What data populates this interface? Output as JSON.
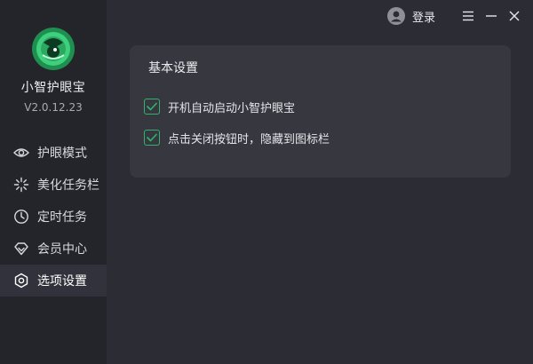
{
  "app": {
    "name": "小智护眼宝",
    "version": "V2.0.12.23"
  },
  "sidebar": {
    "items": [
      {
        "label": "护眼模式",
        "icon": "eye-icon",
        "active": false
      },
      {
        "label": "美化任务栏",
        "icon": "sparkle-icon",
        "active": false
      },
      {
        "label": "定时任务",
        "icon": "clock-icon",
        "active": false
      },
      {
        "label": "会员中心",
        "icon": "diamond-icon",
        "active": false
      },
      {
        "label": "选项设置",
        "icon": "gear-icon",
        "active": true
      }
    ]
  },
  "topbar": {
    "login_label": "登录"
  },
  "settings": {
    "title": "基本设置",
    "options": [
      {
        "label": "开机自动启动小智护眼宝",
        "checked": true
      },
      {
        "label": "点击关闭按钮时，隐藏到图标栏",
        "checked": true
      }
    ]
  },
  "colors": {
    "accent": "#2fb36d",
    "sidebar_bg": "#24252b",
    "main_bg": "#2b2c34",
    "panel_bg": "#37383f"
  }
}
